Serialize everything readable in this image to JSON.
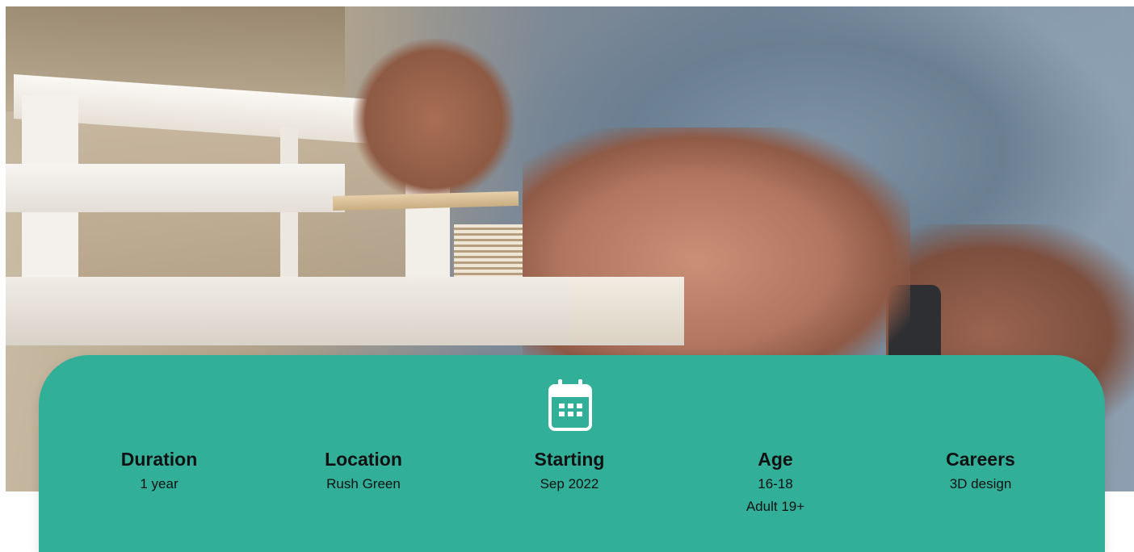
{
  "hero": {
    "image_subject": "architect-model-photo"
  },
  "calendar_icon": "calendar-icon",
  "accent_color": "#32af99",
  "facts": [
    {
      "title": "Duration",
      "values": [
        "1 year"
      ]
    },
    {
      "title": "Location",
      "values": [
        "Rush Green"
      ]
    },
    {
      "title": "Starting",
      "values": [
        "Sep 2022"
      ]
    },
    {
      "title": "Age",
      "values": [
        "16-18",
        "Adult 19+"
      ]
    },
    {
      "title": "Careers",
      "values": [
        "3D design"
      ]
    }
  ]
}
